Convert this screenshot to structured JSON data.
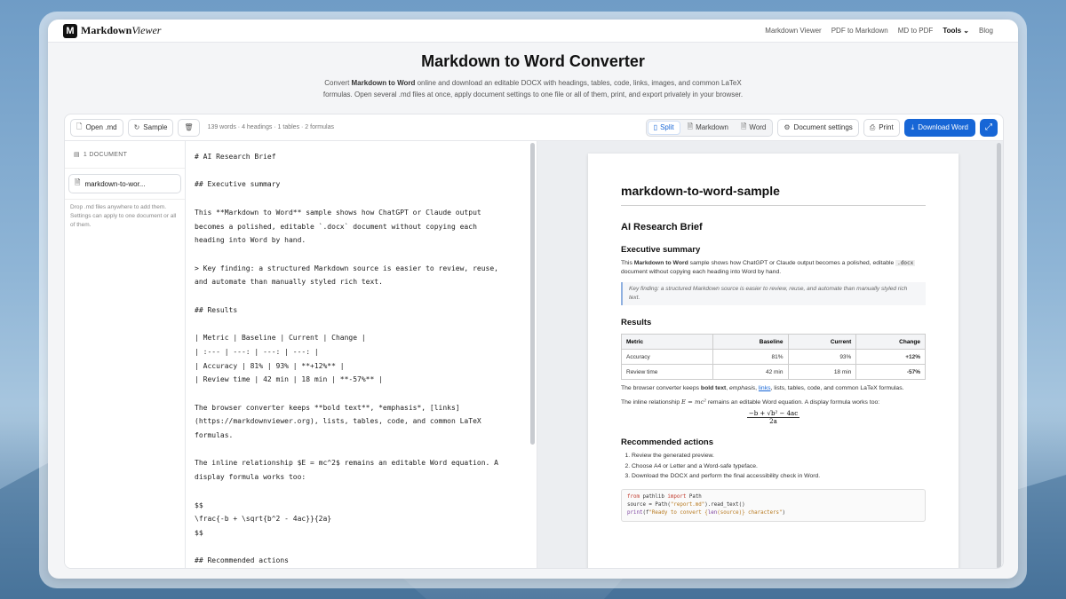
{
  "brand": {
    "logo": "M",
    "name_bold": "Markdown",
    "name_italic": "Viewer"
  },
  "nav": {
    "links": [
      "Markdown Viewer",
      "PDF to Markdown",
      "MD to PDF"
    ],
    "tools": "Tools ⌄",
    "blog": "Blog"
  },
  "hero": {
    "title": "Markdown to Word Converter",
    "desc_pre": "Convert ",
    "desc_bold": "Markdown to Word",
    "desc_post": " online and download an editable DOCX with headings, tables, code, links, images, and common LaTeX formulas. Open several .md files at once, apply document settings to one file or all of them, print, and export privately in your browser."
  },
  "toolbar": {
    "open": "Open .md",
    "sample": "Sample",
    "stats": "139 words · 4 headings · 1 tables · 2 formulas",
    "split": "Split",
    "markdown": "Markdown",
    "word": "Word",
    "settings": "Document settings",
    "print": "Print",
    "download": "Download Word"
  },
  "sidebar": {
    "header": "1 DOCUMENT",
    "doc": "markdown-to-wor...",
    "note": "Drop .md files anywhere to add them. Settings can apply to one document or all of them."
  },
  "editor": {
    "text": "# AI Research Brief\n\n## Executive summary\n\nThis **Markdown to Word** sample shows how ChatGPT or Claude output\nbecomes a polished, editable `.docx` document without copying each\nheading into Word by hand.\n\n> Key finding: a structured Markdown source is easier to review, reuse,\nand automate than manually styled rich text.\n\n## Results\n\n| Metric | Baseline | Current | Change |\n| :--- | ---: | ---: | ---: |\n| Accuracy | 81% | 93% | **+12%** |\n| Review time | 42 min | 18 min | **-57%** |\n\nThe browser converter keeps **bold text**, *emphasis*, [links]\n(https://markdownviewer.org), lists, tables, code, and common LaTeX\nformulas.\n\nThe inline relationship $E = mc^2$ remains an editable Word equation. A\ndisplay formula works too:\n\n$$\n\\frac{-b + \\sqrt{b^2 - 4ac}}{2a}\n$$\n\n## Recommended actions"
  },
  "preview": {
    "title": "markdown-to-word-sample",
    "h1": "AI Research Brief",
    "h2_summary": "Executive summary",
    "p1_a": "This ",
    "p1_bold": "Markdown to Word",
    "p1_b": " sample shows how ChatGPT or Claude output becomes a polished, editable ",
    "p1_code": ".docx",
    "p1_c": " document without copying each heading into Word by hand.",
    "quote": "Key finding: a structured Markdown source is easier to review, reuse, and automate than manually styled rich text.",
    "h2_results": "Results",
    "table": {
      "headers": [
        "Metric",
        "Baseline",
        "Current",
        "Change"
      ],
      "rows": [
        [
          "Accuracy",
          "81%",
          "93%",
          "+12%"
        ],
        [
          "Review time",
          "42 min",
          "18 min",
          "-57%"
        ]
      ]
    },
    "p2_a": "The browser converter keeps ",
    "p2_bold": "bold text",
    "p2_b": ", ",
    "p2_em": "emphasis",
    "p2_c": ", ",
    "p2_link": "links",
    "p2_d": ", lists, tables, code, and common LaTeX formulas.",
    "p3_a": "The inline relationship ",
    "p3_eq": "E = mc²",
    "p3_b": " remains an editable Word equation. A display formula works too:",
    "formula_num": "−b + √b² − 4ac",
    "formula_den": "2a",
    "h2_actions": "Recommended actions",
    "actions": [
      "Review the generated preview.",
      "Choose A4 or Letter and a Word-safe typeface.",
      "Download the DOCX and perform the final accessibility check in Word."
    ],
    "code": {
      "l1_kw1": "from",
      "l1_mod": " pathlib ",
      "l1_kw2": "import",
      "l1_cls": " Path",
      "l2_a": "source = Path(",
      "l2_str": "\"report.md\"",
      "l2_b": ").read_text()",
      "l3_fn": "print",
      "l3_a": "(f",
      "l3_str1": "\"Ready to convert {",
      "l3_fn2": "len",
      "l3_str2": "(source)} characters\"",
      "l3_b": ")"
    }
  },
  "colors": {
    "accent": "#1766d6"
  }
}
